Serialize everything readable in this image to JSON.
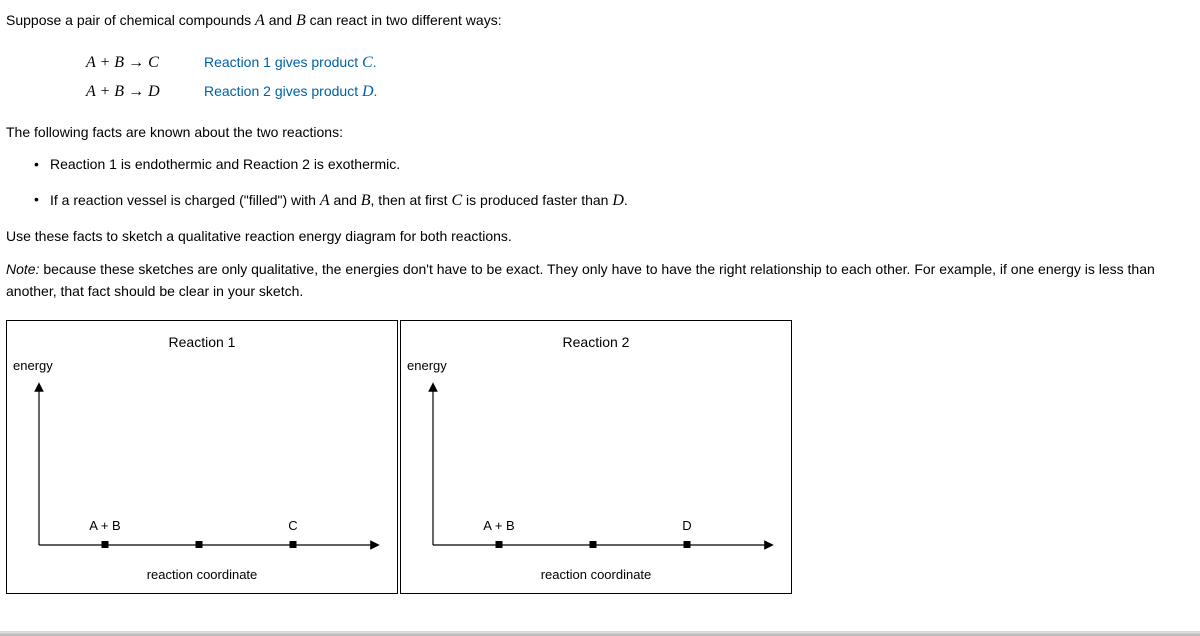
{
  "intro": "Suppose a pair of chemical compounds ",
  "intro_a": "A",
  "intro_and": " and ",
  "intro_b": "B",
  "intro_end": " can react in two different ways:",
  "eq1": {
    "lhs": "A + B",
    "arrow": "→",
    "rhs": "C",
    "desc_prefix": "Reaction 1 gives product ",
    "desc_prod": "C",
    "desc_suffix": "."
  },
  "eq2": {
    "lhs": "A + B",
    "arrow": "→",
    "rhs": "D",
    "desc_prefix": "Reaction 2 gives product ",
    "desc_prod": "D",
    "desc_suffix": "."
  },
  "facts_intro": "The following facts are known about the two reactions:",
  "facts": {
    "0": "Reaction 1 is endothermic and Reaction 2 is exothermic.",
    "1_pre": "If a reaction vessel is charged (\"filled\") with ",
    "1_a": "A",
    "1_and": " and ",
    "1_b": "B",
    "1_mid": ", then at first ",
    "1_c": "C",
    "1_mid2": " is produced faster than ",
    "1_d": "D",
    "1_suf": "."
  },
  "instruction": "Use these facts to sketch a qualitative reaction energy diagram for both reactions.",
  "note_label": "Note:",
  "note_text": " because these sketches are only qualitative, the energies don't have to be exact. They only have to have the right relationship to each other. For example, if one energy is less than another, that fact should be clear in your sketch.",
  "diagram1": {
    "title": "Reaction 1",
    "ylabel": "energy",
    "xlabel": "reaction coordinate",
    "start_label": "A + B",
    "end_label": "C"
  },
  "diagram2": {
    "title": "Reaction 2",
    "ylabel": "energy",
    "xlabel": "reaction coordinate",
    "start_label": "A + B",
    "end_label": "D"
  }
}
